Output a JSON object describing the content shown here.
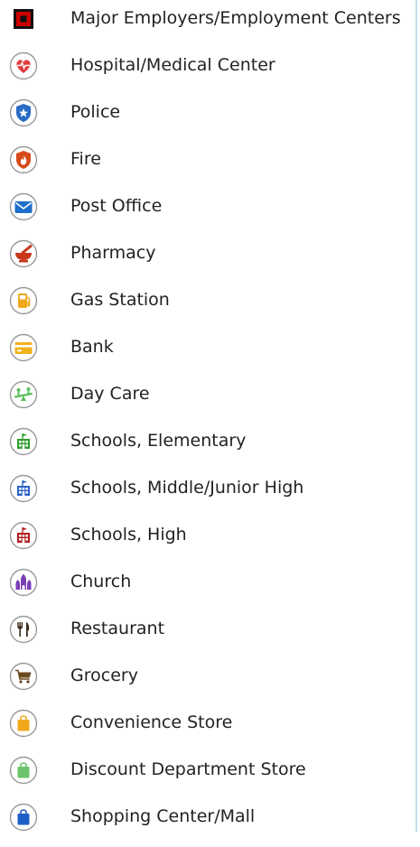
{
  "legend": {
    "items": [
      {
        "label": "Major Employers/Employment Centers",
        "icon": "employer-square-icon",
        "color": "#cc0000"
      },
      {
        "label": "Hospital/Medical Center",
        "icon": "heart-pulse-icon",
        "color": "#e23a3a"
      },
      {
        "label": "Police",
        "icon": "police-badge-icon",
        "color": "#2a6cc4"
      },
      {
        "label": "Fire",
        "icon": "fire-badge-icon",
        "color": "#d84a1b"
      },
      {
        "label": "Post Office",
        "icon": "envelope-icon",
        "color": "#1d6fc9"
      },
      {
        "label": "Pharmacy",
        "icon": "mortar-pestle-icon",
        "color": "#c8371a"
      },
      {
        "label": "Gas Station",
        "icon": "gas-pump-icon",
        "color": "#f0a81b"
      },
      {
        "label": "Bank",
        "icon": "credit-card-icon",
        "color": "#f0b21b"
      },
      {
        "label": "Day Care",
        "icon": "seesaw-icon",
        "color": "#5cbf5c"
      },
      {
        "label": "Schools, Elementary",
        "icon": "school-green-icon",
        "color": "#2e9e2e"
      },
      {
        "label": "Schools, Middle/Junior High",
        "icon": "school-blue-icon",
        "color": "#2a62c4"
      },
      {
        "label": "Schools, High",
        "icon": "school-red-icon",
        "color": "#b21e1e"
      },
      {
        "label": "Church",
        "icon": "church-icon",
        "color": "#7b3fb5"
      },
      {
        "label": "Restaurant",
        "icon": "fork-knife-icon",
        "color": "#5a3a1a"
      },
      {
        "label": "Grocery",
        "icon": "shopping-cart-icon",
        "color": "#6b4a1f"
      },
      {
        "label": "Convenience Store",
        "icon": "shopping-bag-orange-icon",
        "color": "#f0a81b"
      },
      {
        "label": "Discount Department Store",
        "icon": "shopping-bag-green-icon",
        "color": "#6cc36c"
      },
      {
        "label": "Shopping Center/Mall",
        "icon": "shopping-bag-blue-icon",
        "color": "#1d5fc9"
      }
    ]
  }
}
